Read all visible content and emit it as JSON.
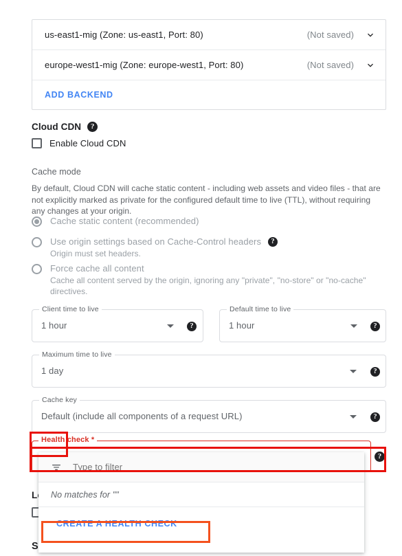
{
  "backends": {
    "rows": [
      {
        "name": "us-east1-mig (Zone: us-east1, Port: 80)",
        "status": "(Not saved)",
        "chevron": "chevron-down-icon"
      },
      {
        "name": "europe-west1-mig (Zone: europe-west1, Port: 80)",
        "status": "(Not saved)",
        "chevron": "chevron-down-icon"
      }
    ],
    "add_backend_label": "ADD BACKEND"
  },
  "cloud_cdn": {
    "title": "Cloud CDN",
    "help": "?",
    "enable_label": "Enable Cloud CDN",
    "cache_mode_label": "Cache mode",
    "description": "By default, Cloud CDN will cache static content - including web assets and video files - that are not explicitly marked as private for the configured default time to live (TTL), without requiring any changes at your origin.",
    "options": [
      {
        "label": "Cache static content (recommended)",
        "selected": true,
        "description": "",
        "help": ""
      },
      {
        "label": "Use origin settings based on Cache-Control headers",
        "selected": false,
        "description": "Origin must set headers.",
        "help": "?"
      },
      {
        "label": "Force cache all content",
        "selected": false,
        "description": "Cache all content served by the origin, ignoring any \"private\", \"no-store\" or \"no-cache\" directives.",
        "help": ""
      }
    ],
    "fields": [
      {
        "label": "Client time to live",
        "value": "1 hour",
        "help": "?"
      },
      {
        "label": "Default time to live",
        "value": "1 hour",
        "help": "?"
      },
      {
        "label": "Maximum time to live",
        "value": "1 day",
        "help": "?"
      },
      {
        "label": "Cache key",
        "value": "Default (include all components of a request URL)",
        "help": "?"
      }
    ]
  },
  "health_check": {
    "label": "Health check *",
    "help": "?",
    "value": "",
    "dropdown": {
      "filter_icon": "filter-list-icon",
      "filter_placeholder": "Type to filter",
      "filter_value": "",
      "no_matches": "No matches for \"\"",
      "create_label": "CREATE A HEALTH CHECK"
    }
  },
  "logging": {
    "title": "Logging"
  },
  "security": {
    "title": "Security"
  },
  "colors": {
    "link_blue": "#4285f4",
    "error_red": "#d93025",
    "annotation_red": "#e8110b",
    "annotation_orange": "#f4511e",
    "text_primary": "#202124",
    "text_secondary": "#5f6368",
    "text_disabled": "#9aa0a6",
    "border": "#dadce0"
  }
}
